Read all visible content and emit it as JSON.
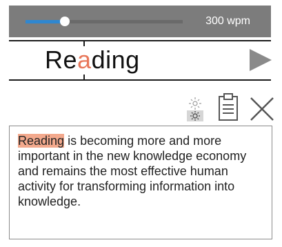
{
  "speed": {
    "label": "300 wpm",
    "slider_position": 0.25
  },
  "rsvp": {
    "word_prefix": "Re",
    "word_focus": "a",
    "word_suffix": "ding",
    "focus_color": "#e8775a"
  },
  "toolbar": {
    "brightness_icon": "brightness-icon",
    "clipboard_icon": "clipboard-icon",
    "close_icon": "close-icon"
  },
  "text": {
    "highlighted_word": "Reading",
    "rest": " is becoming more and more important in the new knowledge economy and remains the most effective human activity for transforming information into knowledge.",
    "highlight_color": "#f3a98d"
  },
  "colors": {
    "accent": "#2f87d0",
    "bar_background": "#7c7c7c"
  }
}
